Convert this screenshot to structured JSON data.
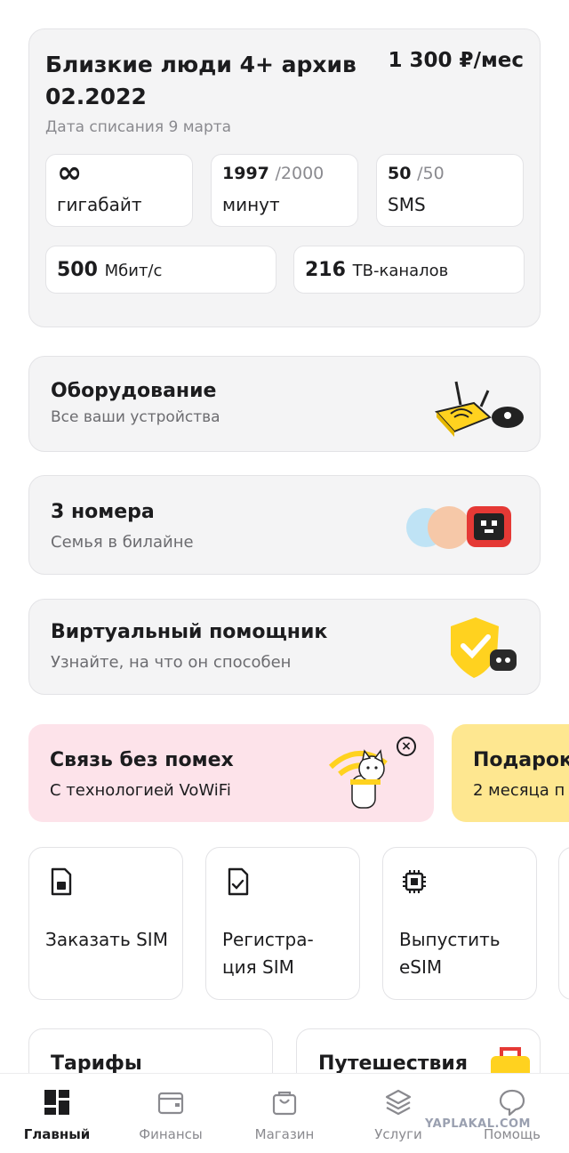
{
  "tariff": {
    "title": "Близкие люди 4+ архив 02.2022",
    "price": "1 300 ₽/мес",
    "charge_date": "Дата списания 9 марта",
    "internet": {
      "value": "∞",
      "label": "гигабайт"
    },
    "minutes": {
      "used": "1997",
      "total": "/2000",
      "label": "минут"
    },
    "sms": {
      "used": "50",
      "total": "/50",
      "label": "SMS"
    },
    "speed": {
      "value": "500",
      "unit": "Мбит/с"
    },
    "tv": {
      "value": "216",
      "unit": "ТВ-каналов"
    }
  },
  "equipment": {
    "title": "Оборудование",
    "subtitle": "Все ваши устройства"
  },
  "family": {
    "title": "3 номера",
    "subtitle": "Семья в билайне"
  },
  "assistant": {
    "title": "Виртуальный помощник",
    "subtitle": "Узнайте, на что он способен"
  },
  "promos": [
    {
      "title": "Связь без помех",
      "subtitle": "С технологией VoWiFi",
      "color": "#fde3ea"
    },
    {
      "title": "Подарок",
      "subtitle": "2 месяца п",
      "color": "#fee790"
    }
  ],
  "actions": [
    {
      "label": "Заказать SIM",
      "icon": "sim-card-icon"
    },
    {
      "label": "Регистра-ция SIM",
      "icon": "sim-check-icon"
    },
    {
      "label": "Выпустить eSIM",
      "icon": "chip-icon"
    }
  ],
  "bottom_cards": [
    {
      "title": "Тарифы"
    },
    {
      "title": "Путешествия"
    }
  ],
  "tabs": [
    {
      "label": "Главный",
      "icon": "home-grid-icon",
      "active": true
    },
    {
      "label": "Финансы",
      "icon": "wallet-icon",
      "active": false
    },
    {
      "label": "Магазин",
      "icon": "shopping-bag-icon",
      "active": false
    },
    {
      "label": "Услуги",
      "icon": "layers-icon",
      "active": false
    },
    {
      "label": "Помощь",
      "icon": "chat-bubble-icon",
      "active": false
    }
  ],
  "watermark": "YAPLAKAL.COM",
  "colors": {
    "accent": "#ffd21f",
    "promo_pink": "#fde3ea",
    "promo_yellow": "#fee790"
  }
}
